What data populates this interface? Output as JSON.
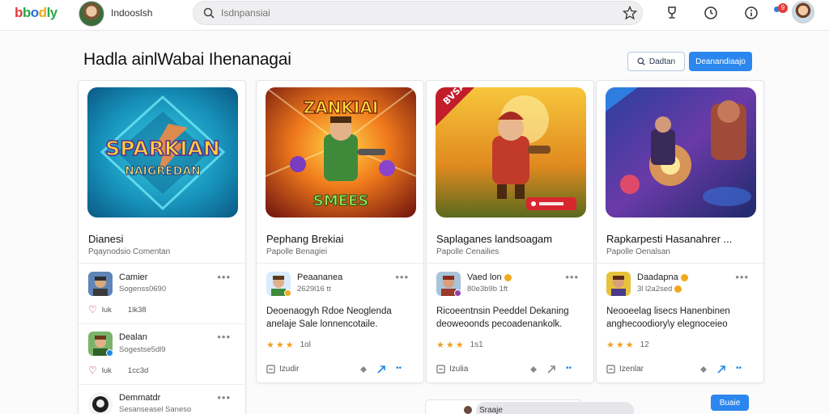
{
  "app": {
    "logo_parts": [
      "b",
      "b",
      "o",
      "d",
      "ly"
    ],
    "username": "Indooslsh",
    "search_placeholder": "Isdnpansiai",
    "notification_count": "9"
  },
  "page": {
    "title": "Hadla ainlWabai Ihenanagai",
    "search_button": "Dadtan",
    "primary_button": "Deanandiaajo"
  },
  "cards": [
    {
      "art_text_1": "SPARKIAN",
      "art_text_2": "NAIGREDAN",
      "title": "Dianesi",
      "subtitle": "Pqaynodsio Comentan",
      "posts": [
        {
          "name": "Camier",
          "meta": "Sogenss0690",
          "reactions": [
            "luk",
            "1lk38"
          ]
        },
        {
          "name": "Dealan",
          "meta": "Sogestse5dl9",
          "reactions": [
            "luk",
            "1cc3d"
          ]
        },
        {
          "name": "Demmatdr",
          "meta": "Sesanseasel Saneso"
        }
      ]
    },
    {
      "art_text_1": "ZANKIAI",
      "art_text_2": "SMEES",
      "title": "Pephang Brekiai",
      "subtitle": "Papolle Benagiei",
      "post": {
        "name": "Peaananea",
        "meta": "2629l16 tt"
      },
      "body": "Deoenaogyh Rdoe Neoglenda anelaje Sale lonnencotaile.",
      "rating_count": "1ol",
      "reply_label": "Izudir"
    },
    {
      "art_text_1": "BVSA",
      "art_text_2": "",
      "title": "Saplaganes landsoagam",
      "subtitle": "Papolle Cenailies",
      "post": {
        "name": "Vaed lon",
        "meta": "80e3b9b 1ft"
      },
      "body": "Ricoeentnsin Peeddel Dekaning deoweoonds pecoadenankolk.",
      "rating_count": "1s1",
      "reply_label": "Izulia"
    },
    {
      "art_text_1": "",
      "art_text_2": "",
      "title": "Rapkarpesti Hasanahrer ...",
      "subtitle": "Papolle Oenalsan",
      "post": {
        "name": "Daadapna",
        "meta": "3l l2a2sed"
      },
      "body": "Neooeelag lisecs Hanenbinen anghecoodiory\\y elegnoceieo",
      "rating_count": "12",
      "reply_label": "Izenlar"
    }
  ],
  "bottom": {
    "pill_label": "Sraaje",
    "button": "Buaie"
  },
  "colors": {
    "accent": "#2b86ee",
    "star": "#f0a020",
    "heart": "#c2185b"
  }
}
